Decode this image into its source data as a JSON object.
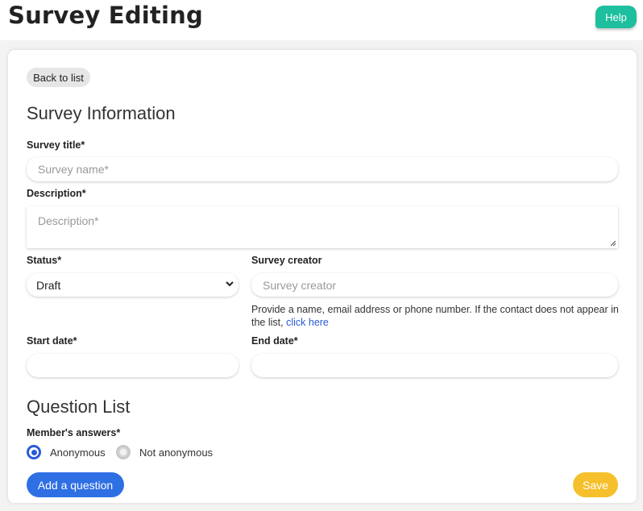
{
  "header": {
    "title": "Survey Editing",
    "help_label": "Help"
  },
  "nav": {
    "back_label": "Back to list"
  },
  "survey_info": {
    "section_title": "Survey Information",
    "title_label": "Survey title*",
    "title_placeholder": "Survey name*",
    "description_label": "Description*",
    "description_placeholder": "Description*",
    "status_label": "Status*",
    "status_value": "Draft",
    "creator_label": "Survey creator",
    "creator_placeholder": "Survey creator",
    "creator_hint": "Provide a name, email address or phone number. If the contact does not appear in the list,",
    "creator_hint_link": "click here",
    "start_label": "Start date*",
    "end_label": "End date*"
  },
  "question_list": {
    "section_title": "Question List",
    "answers_label": "Member's answers*",
    "option_anonymous": "Anonymous",
    "option_not_anonymous": "Not anonymous",
    "selected": "Anonymous",
    "add_label": "Add a question"
  },
  "actions": {
    "save_label": "Save"
  },
  "colors": {
    "help": "#1dbf9e",
    "primary": "#2f6fe4",
    "save": "#f5c02c",
    "link": "#2a5bd7"
  }
}
